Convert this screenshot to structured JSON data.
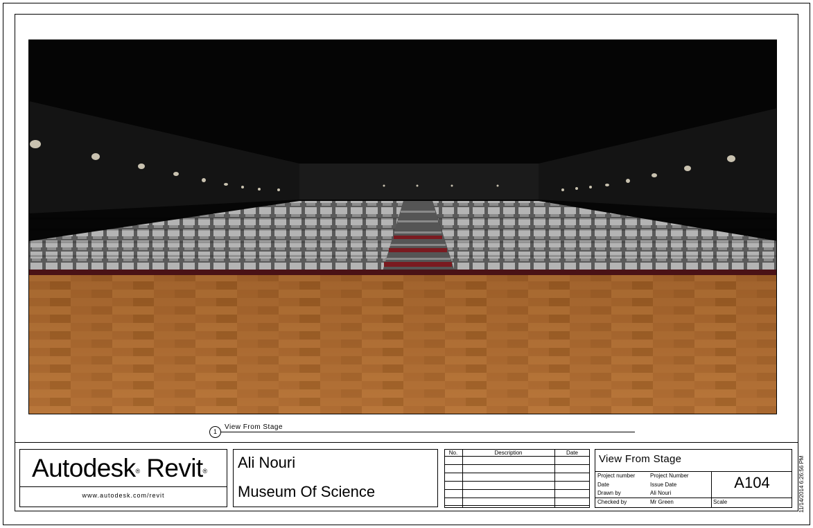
{
  "view": {
    "number": "1",
    "title": "View From Stage"
  },
  "logo": {
    "brand": "Autodesk",
    "product": "Revit",
    "url": "www.autodesk.com/revit"
  },
  "project": {
    "owner": "Ali Nouri",
    "name": "Museum Of Science"
  },
  "revisions": {
    "headers": [
      "No.",
      "Description",
      "Date"
    ]
  },
  "sheet": {
    "name": "View From Stage",
    "fields": [
      {
        "label": "Project number",
        "value": "Project Number"
      },
      {
        "label": "Date",
        "value": "Issue Date"
      },
      {
        "label": "Drawn by",
        "value": "Ali Nouri"
      },
      {
        "label": "Checked by",
        "value": "Mr Green"
      }
    ],
    "number": "A104",
    "scale_label": "Scale"
  },
  "datestamp": "11/14/2014 6:26:56 PM",
  "colors": {
    "floor_wood": "#a8662e",
    "seats": "#a9a9a9",
    "carpet": "#7a1a20",
    "walls": "#111111"
  }
}
